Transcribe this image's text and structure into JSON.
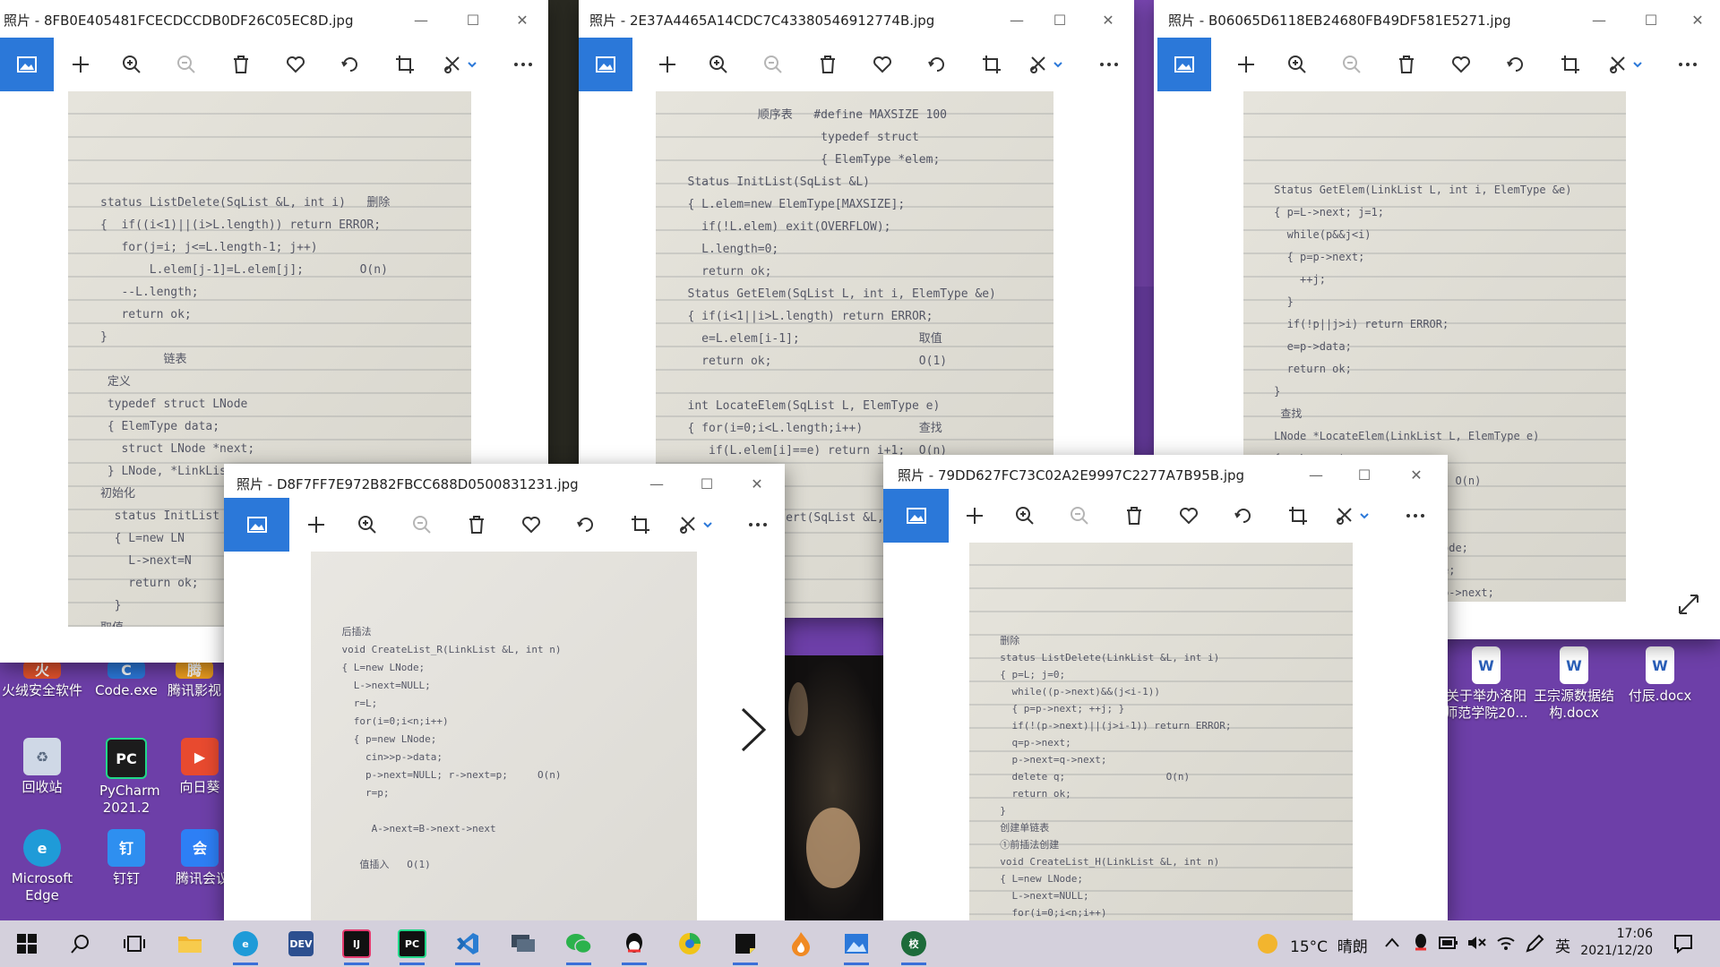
{
  "desktop_icons": [
    {
      "label": "火绒安全软件",
      "color": "#e2522c",
      "glyph": "火"
    },
    {
      "label": "Code.exe",
      "color": "#2b78d9",
      "glyph": "C"
    },
    {
      "label": "腾讯影视",
      "color": "#f0a020",
      "glyph": "腾"
    },
    {
      "label": "回收站",
      "color": "#cfd8e6",
      "glyph": "♻"
    },
    {
      "label": "PyCharm 2021.2",
      "color": "#1c1c1c",
      "glyph": "PC"
    },
    {
      "label": "向日葵",
      "color": "#e84a2f",
      "glyph": "▶"
    },
    {
      "label": "Microsoft Edge",
      "color": "#1f9bd8",
      "glyph": "e"
    },
    {
      "label": "钉钉",
      "color": "#2e8ff0",
      "glyph": "钉"
    },
    {
      "label": "腾讯会议",
      "color": "#2d7ff5",
      "glyph": "会"
    },
    {
      "label": "关于举办洛阳师范学院20...",
      "color": "#2b5fb8",
      "glyph": "W"
    },
    {
      "label": "王宗源数据结构.docx",
      "color": "#2b5fb8",
      "glyph": "W"
    },
    {
      "label": "付辰.docx",
      "color": "#2b5fb8",
      "glyph": "W"
    }
  ],
  "windows": [
    {
      "title": "照片 - 8FB0E405481FCECDCCDB0DF26C05EC8D.jpg"
    },
    {
      "title": "照片 - 2E37A4465A14CDC7C43380546912774B.jpg"
    },
    {
      "title": "照片 - B06065D6118EB24680FB49DF581E5271.jpg"
    },
    {
      "title": "照片 - D8F7FF7E972B82FBCC688D0500831231.jpg"
    },
    {
      "title": "照片 - 79DD627FC73C02A2E9997C2277A7B95B.jpg"
    }
  ],
  "toolbar_icons": [
    "image-icon",
    "add-icon",
    "zoom-in-icon",
    "zoom-out-icon",
    "delete-icon",
    "favorite-icon",
    "rotate-icon",
    "crop-icon",
    "edit-icon",
    "more-icon"
  ],
  "notes": {
    "w1": "status ListDelete(SqList &L, int i)   删除\n{  if((i<1)||(i>L.length)) return ERROR;\n   for(j=i; j<=L.length-1; j++)\n       L.elem[j-1]=L.elem[j];        O(n)\n   --L.length;\n   return ok;\n}\n         链表\n 定义\n typedef struct LNode\n { ElemType data;\n   struct LNode *next;\n } LNode, *LinkList;\n初始化\n  status InitList\n  { L=new LN\n    L->next=N\n    return ok;\n  }\n取值",
    "w2": "          顺序表   #define MAXSIZE 100\n                   typedef struct\n                   { ElemType *elem;\nStatus InitList(SqList &L)\n{ L.elem=new ElemType[MAXSIZE];\n  if(!L.elem) exit(OVERFLOW);\n  L.length=0;\n  return ok;\nStatus GetElem(SqList L, int i, ElemType &e)\n{ if(i<1||i>L.length) return ERROR;\n  e=L.elem[i-1];                 取值\n  return ok;                     O(1)\n\nint LocateElem(SqList L, ElemType e)\n{ for(i=0;i<L.length;i++)        查找\n   if(L.elem[i]==e) return i+1;  O(n)\n  return 0;\n}\nStatus ListInsert(SqList &L, int i, ElemType e)",
    "w3": "Status GetElem(LinkList L, int i, ElemType &e)\n{ p=L->next; j=1;\n  while(p&&j<i)\n  { p=p->next;\n    ++j;\n  }\n  if(!p||j>i) return ERROR;\n  e=p->data;\n  return ok;\n}\n 查找\nLNode *LocateElem(LinkList L, ElemType e)\n{ p=L->next;\n  while(p&&p->data!=e)      O(n)\n    p=p->next;\n\n                  s=new LNode;\n                  s->data=e;\n                  s->next=p->next;\n                  p->next=s;",
    "w4": "后插法\nvoid CreateList_R(LinkList &L, int n)\n{ L=new LNode;\n  L->next=NULL;\n  r=L;\n  for(i=0;i<n;i++)\n  { p=new LNode;\n    cin>>p->data;\n    p->next=NULL; r->next=p;     O(n)\n    r=p;\n\n     A->next=B->next->next\n\n   值插入   O(1)",
    "w5": "删除\nstatus ListDelete(LinkList &L, int i)\n{ p=L; j=0;\n  while((p->next)&&(j<i-1))\n  { p=p->next; ++j; }\n  if(!(p->next)||(j>i-1)) return ERROR;\n  q=p->next;\n  p->next=q->next;\n  delete q;                 O(n)\n  return ok;\n}\n创建单链表\n①前插法创建\nvoid CreateList_H(LinkList &L, int n)\n{ L=new LNode;\n  L->next=NULL;\n  for(i=0;i<n;i++)\n  { p=new LNode;"
  },
  "taskbar_apps": [
    {
      "name": "windows-start-icon",
      "color": "#111111",
      "glyph": "⊞"
    },
    {
      "name": "search-icon",
      "color": "#111111",
      "glyph": "⌕"
    },
    {
      "name": "task-view-icon",
      "color": "#111111",
      "glyph": "❐"
    },
    {
      "name": "file-explorer-icon",
      "color": "#f2b52e",
      "glyph": ""
    },
    {
      "name": "edge-icon",
      "color": "#1f9bd8",
      "glyph": "e"
    },
    {
      "name": "dev-cpp-icon",
      "color": "#2c4f8f",
      "glyph": "DEV"
    },
    {
      "name": "intellij-icon",
      "color": "#e53b6f",
      "glyph": "IJ"
    },
    {
      "name": "pycharm-icon",
      "color": "#1c1c1c",
      "glyph": "PC"
    },
    {
      "name": "vscode-icon",
      "color": "#2a7dd2",
      "glyph": "⟨⟩"
    },
    {
      "name": "remote-desktop-icon",
      "color": "#3b4a5c",
      "glyph": "▭"
    },
    {
      "name": "wechat-icon",
      "color": "#2bb24c",
      "glyph": "✉"
    },
    {
      "name": "qq-icon",
      "color": "#111111",
      "glyph": "Q"
    },
    {
      "name": "browser-icon",
      "color": "#f0c419",
      "glyph": "●"
    },
    {
      "name": "sticky-notes-icon",
      "color": "#222222",
      "glyph": "▰"
    },
    {
      "name": "huorong-icon",
      "color": "#f08a24",
      "glyph": "火"
    },
    {
      "name": "photos-icon",
      "color": "#2b78d9",
      "glyph": "▲"
    },
    {
      "name": "school-app-icon",
      "color": "#1d6b3a",
      "glyph": "校"
    }
  ],
  "tray": {
    "weather": "15°C  晴朗",
    "ime": "英",
    "time": "17:06",
    "date": "2021/12/20"
  }
}
